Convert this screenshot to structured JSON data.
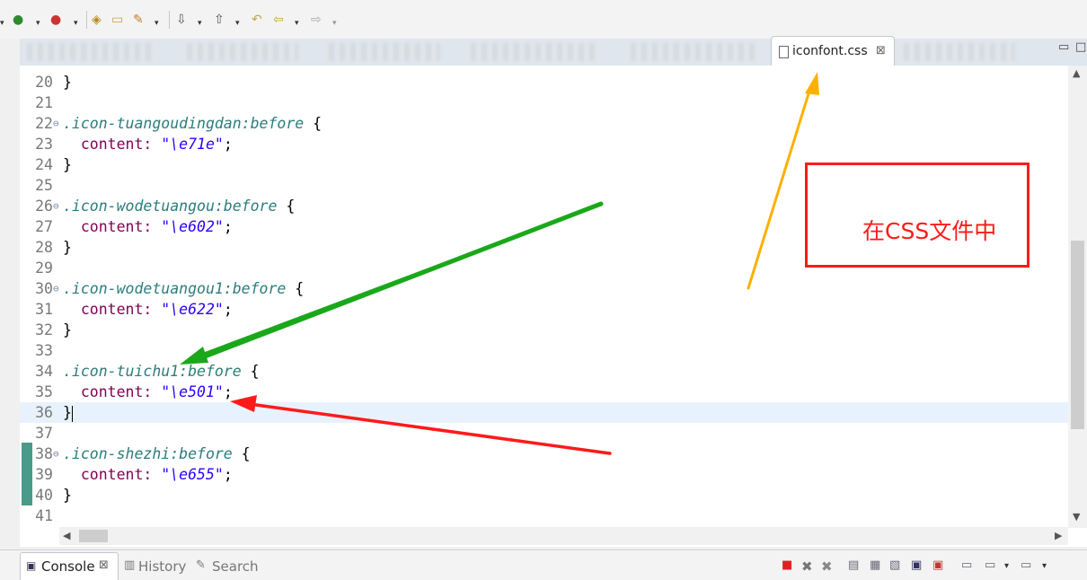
{
  "window": {
    "toolbar_dropdown_glyph": "▾",
    "window_controls": [
      "▭",
      "□"
    ]
  },
  "editor": {
    "active_tab": {
      "filename": "iconfont.css",
      "close_glyph": "⊠"
    },
    "lines": [
      {
        "n": "20",
        "code": "}"
      },
      {
        "n": "21",
        "code": ""
      },
      {
        "n": "22",
        "selector": ".icon-tuangoudingdan:before",
        "brace": " {",
        "fold": true
      },
      {
        "n": "23",
        "prop": "  content:",
        "value": "\"\\e71e\"",
        "end": ";"
      },
      {
        "n": "24",
        "code": "}"
      },
      {
        "n": "25",
        "code": ""
      },
      {
        "n": "26",
        "selector": ".icon-wodetuangou:before",
        "brace": " {",
        "fold": true
      },
      {
        "n": "27",
        "prop": "  content:",
        "value": "\"\\e602\"",
        "end": ";"
      },
      {
        "n": "28",
        "code": "}"
      },
      {
        "n": "29",
        "code": ""
      },
      {
        "n": "30",
        "selector": ".icon-wodetuangou1:before",
        "brace": " {",
        "fold": true
      },
      {
        "n": "31",
        "prop": "  content:",
        "value": "\"\\e622\"",
        "end": ";"
      },
      {
        "n": "32",
        "code": "}"
      },
      {
        "n": "33",
        "code": ""
      },
      {
        "n": "34",
        "selector": ".icon-tuichu1:before",
        "brace": " {",
        "fold": false
      },
      {
        "n": "35",
        "prop": "  content:",
        "value": "\"\\e501\"",
        "end": ";"
      },
      {
        "n": "36",
        "code": "}",
        "current": true
      },
      {
        "n": "37",
        "code": ""
      },
      {
        "n": "38",
        "selector": ".icon-shezhi:before",
        "brace": " {",
        "fold": true
      },
      {
        "n": "39",
        "prop": "  content:",
        "value": "\"\\e655\"",
        "end": ";"
      },
      {
        "n": "40",
        "code": "}"
      },
      {
        "n": "41",
        "code": ""
      }
    ]
  },
  "annotation": {
    "text": "在CSS文件中",
    "color": "#ff1a1a"
  },
  "bottom_panel": {
    "tabs": [
      {
        "label": "Console",
        "active": true
      },
      {
        "label": "History",
        "active": false
      },
      {
        "label": "Search",
        "active": false
      }
    ],
    "close_glyph": "⊠"
  },
  "colors": {
    "selector": "#2c7c7c",
    "property": "#7f0055",
    "string": "#2a00ff",
    "arrow_green": "#1aa81a",
    "arrow_red": "#ff1a1a",
    "arrow_orange": "#ffb000"
  }
}
